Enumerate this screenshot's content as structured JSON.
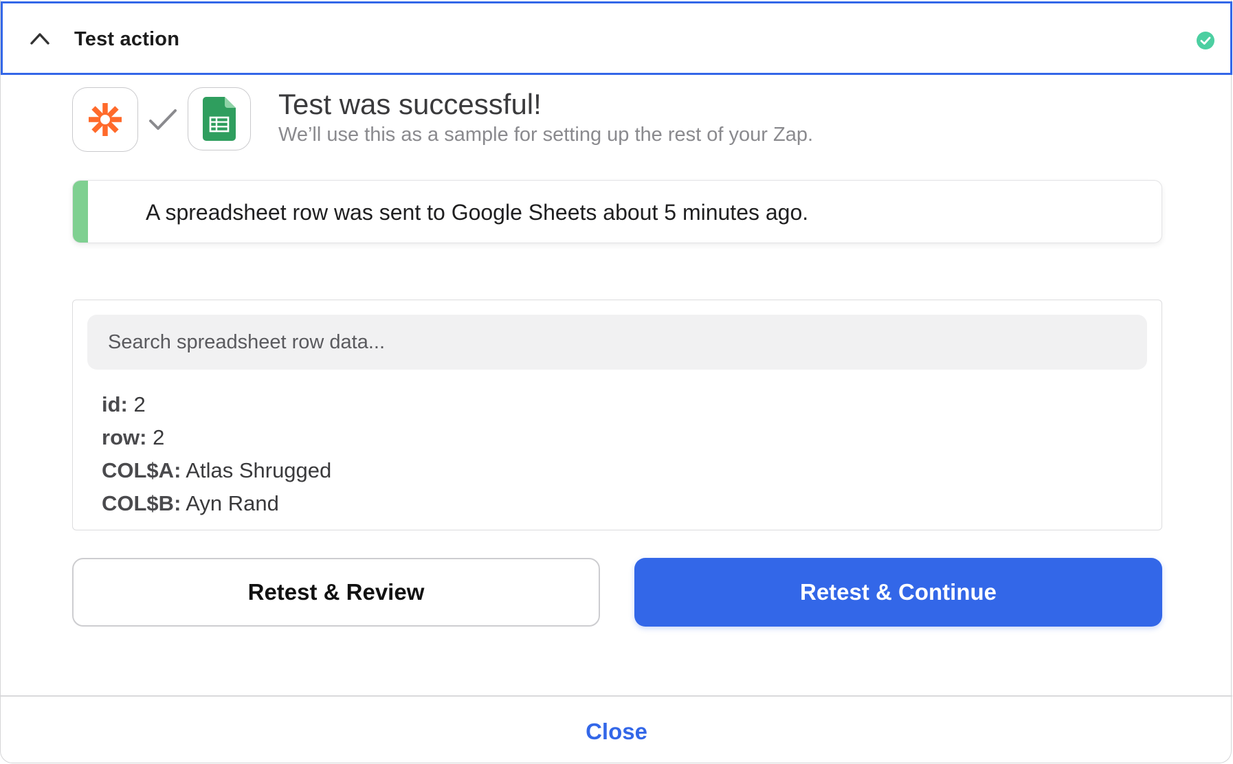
{
  "header": {
    "title": "Test action",
    "collapse_icon": "chevron-up-icon",
    "status_icon": "check-circle-icon",
    "status_color": "#4ccfa1"
  },
  "apps": {
    "source_icon": "zapier-asterisk-icon",
    "source_color": "#ff6a2b",
    "connector_icon": "checkmark-icon",
    "target_icon": "google-sheets-icon",
    "target_color": "#2f9e5e"
  },
  "result": {
    "title": "Test was successful!",
    "subtitle": "We’ll use this as a sample for setting up the rest of your Zap."
  },
  "notice": {
    "text": "A spreadsheet row was sent to Google Sheets about 5 minutes ago.",
    "accent_color": "#7fd091"
  },
  "search": {
    "placeholder": "Search spreadsheet row data..."
  },
  "fields": [
    {
      "key": "id:",
      "value": "2"
    },
    {
      "key": "row:",
      "value": "2"
    },
    {
      "key": "COL$A:",
      "value": "Atlas Shrugged"
    },
    {
      "key": "COL$B:",
      "value": "Ayn Rand"
    }
  ],
  "actions": {
    "review_label": "Retest & Review",
    "continue_label": "Retest & Continue",
    "primary_color": "#3367e8"
  },
  "footer": {
    "close_label": "Close"
  }
}
